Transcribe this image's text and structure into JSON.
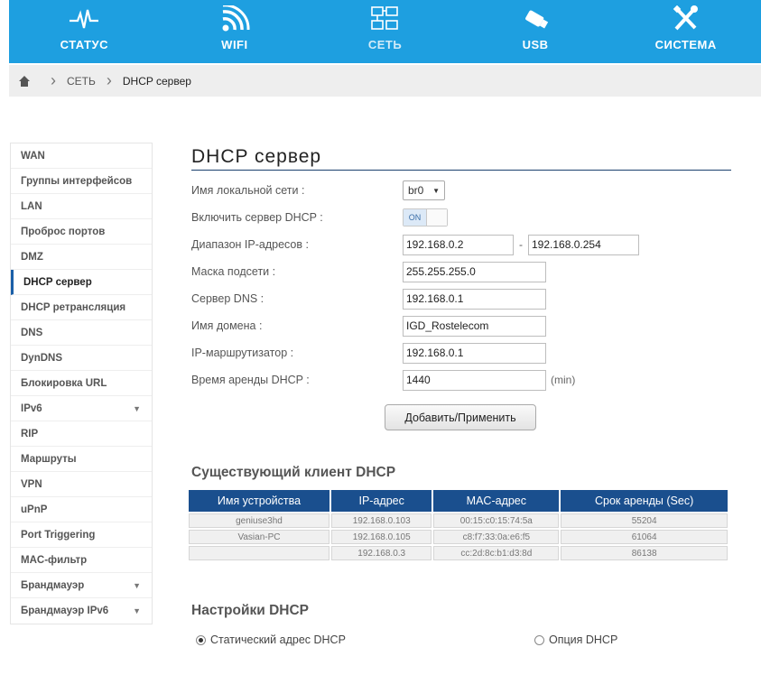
{
  "nav": {
    "items": [
      {
        "label": "СТАТУС",
        "icon": "pulse-icon"
      },
      {
        "label": "WIFI",
        "icon": "wifi-icon"
      },
      {
        "label": "СЕТЬ",
        "icon": "network-icon"
      },
      {
        "label": "USB",
        "icon": "usb-icon"
      },
      {
        "label": "СИСТЕМА",
        "icon": "tools-icon"
      }
    ],
    "active_index": 2
  },
  "breadcrumb": {
    "home_icon": "home-icon",
    "items": [
      "СЕТЬ",
      "DHCP сервер"
    ]
  },
  "sidebar": {
    "items": [
      {
        "label": "WAN"
      },
      {
        "label": "Группы интерфейсов"
      },
      {
        "label": "LAN"
      },
      {
        "label": "Проброс портов"
      },
      {
        "label": "DMZ"
      },
      {
        "label": "DHCP сервер",
        "active": true
      },
      {
        "label": "DHCP ретрансляция"
      },
      {
        "label": "DNS"
      },
      {
        "label": "DynDNS"
      },
      {
        "label": "Блокировка URL"
      },
      {
        "label": "IPv6",
        "expandable": true
      },
      {
        "label": "RIP"
      },
      {
        "label": "Маршруты"
      },
      {
        "label": "VPN"
      },
      {
        "label": "uPnP"
      },
      {
        "label": "Port Triggering"
      },
      {
        "label": "MAC-фильтр"
      },
      {
        "label": "Брандмауэр",
        "expandable": true
      },
      {
        "label": "Брандмауэр IPv6",
        "expandable": true
      }
    ]
  },
  "main": {
    "title": "DHCP сервер",
    "form": {
      "lan_name_label": "Имя локальной сети :",
      "lan_name_value": "br0",
      "dhcp_enable_label": "Включить сервер DHCP :",
      "dhcp_enable_state": "ON",
      "ip_range_label": "Диапазон IP-адресов :",
      "ip_range_start": "192.168.0.2",
      "ip_range_dash": "-",
      "ip_range_end": "192.168.0.254",
      "subnet_label": "Маска подсети :",
      "subnet_value": "255.255.255.0",
      "dns_label": "Сервер DNS :",
      "dns_value": "192.168.0.1",
      "domain_label": "Имя домена :",
      "domain_value": "IGD_Rostelecom",
      "router_label": "IP-маршрутизатор :",
      "router_value": "192.168.0.1",
      "lease_label": "Время аренды DHCP :",
      "lease_value": "1440",
      "lease_unit": "(min)",
      "apply_label": "Добавить/Применить"
    },
    "clients": {
      "title": "Существующий клиент DHCP",
      "headers": [
        "Имя устройства",
        "IP-адрес",
        "MAC-адрес",
        "Срок аренды (Sec)"
      ],
      "rows": [
        [
          "geniuse3hd",
          "192.168.0.103",
          "00:15:c0:15:74:5a",
          "55204"
        ],
        [
          "Vasian-PC",
          "192.168.0.105",
          "c8:f7:33:0a:e6:f5",
          "61064"
        ],
        [
          "",
          "192.168.0.3",
          "cc:2d:8c:b1:d3:8d",
          "86138"
        ]
      ]
    },
    "settings": {
      "title": "Настройки DHCP",
      "static_label": "Статический адрес DHCP",
      "option_label": "Опция DHCP",
      "selected": "static"
    }
  },
  "colors": {
    "nav_bg": "#1e9fe0",
    "table_header": "#1a4f8e",
    "active_marker": "#1a5fa8"
  }
}
